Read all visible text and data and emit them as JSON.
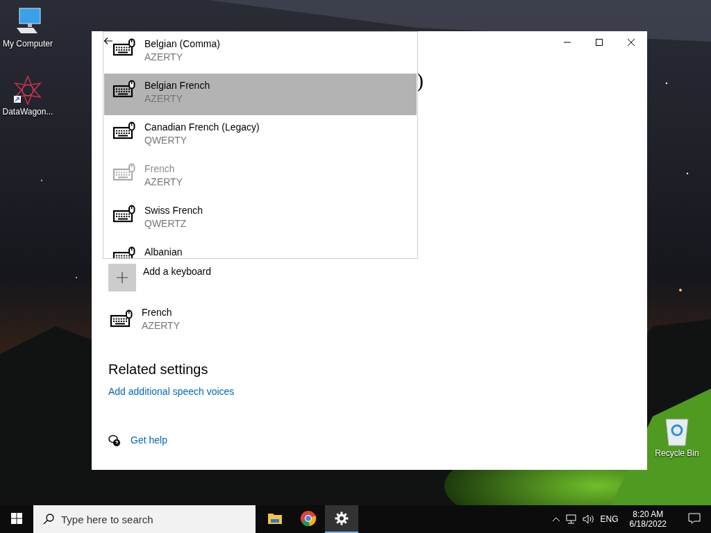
{
  "desktop_icons": [
    {
      "label": "My Computer",
      "kind": "computer"
    },
    {
      "label": "DataWagon...",
      "kind": "shortcut"
    },
    {
      "label": "Recycle Bin",
      "kind": "recycle"
    }
  ],
  "window": {
    "heading_fragment": ")"
  },
  "layout_dropdown": {
    "items": [
      {
        "name": "Belgian (Comma)",
        "layout": "AZERTY",
        "selected": false,
        "disabled": false
      },
      {
        "name": "Belgian French",
        "layout": "AZERTY",
        "selected": true,
        "disabled": false
      },
      {
        "name": "Canadian French (Legacy)",
        "layout": "QWERTY",
        "selected": false,
        "disabled": false
      },
      {
        "name": "French",
        "layout": "AZERTY",
        "selected": false,
        "disabled": true
      },
      {
        "name": "Swiss French",
        "layout": "QWERTZ",
        "selected": false,
        "disabled": false
      },
      {
        "name": "Albanian",
        "selected": false,
        "disabled": false
      }
    ]
  },
  "add_keyboard": {
    "label": "Add a keyboard"
  },
  "installed_keyboards": [
    {
      "name": "French",
      "layout": "AZERTY"
    }
  ],
  "related_settings": {
    "heading": "Related settings",
    "links": [
      "Add additional speech voices"
    ]
  },
  "help": {
    "label": "Get help"
  },
  "taskbar": {
    "search": {
      "placeholder": "Type here to search"
    },
    "apps": [
      {
        "kind": "explorer",
        "selected": false
      },
      {
        "kind": "chrome",
        "selected": false
      },
      {
        "kind": "settings",
        "selected": true
      }
    ],
    "language": "ENG",
    "time": "8:20 AM",
    "date": "6/18/2022"
  }
}
